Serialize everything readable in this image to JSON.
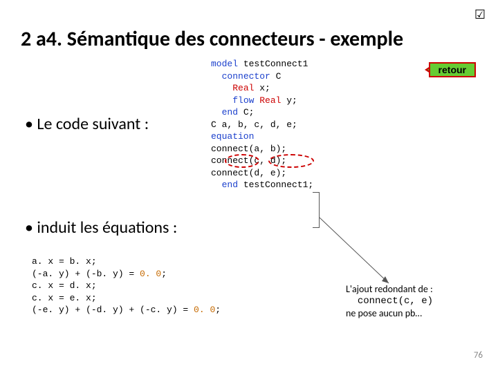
{
  "checkbox_glyph": "☑",
  "title": "2 a4. Sémantique des connecteurs - exemple",
  "retour_label": "retour",
  "bullet1": "Le code suivant :",
  "bullet2": "induit les équations :",
  "code1": {
    "l1_kw": "model",
    "l1_rest": " testConnect1",
    "l2_blank": " ",
    "l3_kw": "connector",
    "l3_rest": " C",
    "l4_ty": "Real",
    "l4_rest": " x;",
    "l5_kw": "flow ",
    "l5_ty": "Real",
    "l5_rest": " y;",
    "l6_kw": "end",
    "l6_rest": " C;",
    "l7_blank": " ",
    "l8": "  C a, b, c, d, e;",
    "l9_blank": " ",
    "l10_kw": "equation",
    "l11": "    connect(a, b);",
    "l12": "    connect(c, d);",
    "l13": "    connect(d, e);",
    "l14_kw": "end",
    "l14_rest": " testConnect1;"
  },
  "code2": {
    "l1": "a. x = b. x;",
    "l2a": "(-a. y) + (-b. y) = ",
    "l2n": "0. 0",
    "l2b": ";",
    "l3": "c. x = d. x;",
    "l4": "c. x = e. x;",
    "l5a": "(-e. y) + (-d. y) + (-c. y) = ",
    "l5n": "0. 0",
    "l5b": ";"
  },
  "note": {
    "l1": "L'ajout redondant de :",
    "l2": "connect(c, e)",
    "l3": "ne pose aucun pb…"
  },
  "page_number": "76"
}
